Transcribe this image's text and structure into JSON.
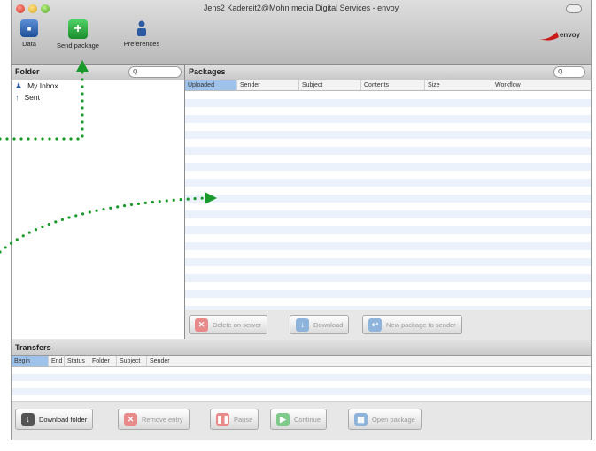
{
  "window": {
    "title": "Jens2 Kadereit2@Mohn media Digital Services - envoy"
  },
  "toolbar": {
    "data_label": "Data",
    "send_label": "Send package",
    "prefs_label": "Preferences"
  },
  "brand": {
    "logo_text": "envoy",
    "accent": "#cc1a1a"
  },
  "folders": {
    "header": "Folder",
    "search_placeholder": "Q",
    "items": [
      {
        "label": "My Inbox"
      },
      {
        "label": "Sent"
      }
    ]
  },
  "packages": {
    "header": "Packages",
    "search_placeholder": "Q",
    "columns": [
      "Uploaded",
      "Sender",
      "Subject",
      "Contents",
      "Size",
      "Workflow"
    ],
    "buttons": {
      "delete": "Delete on server",
      "download": "Download",
      "newpkg": "New package to sender"
    }
  },
  "transfers": {
    "header": "Transfers",
    "columns": [
      "Begin",
      "End",
      "Status",
      "Folder",
      "Subject",
      "Sender"
    ],
    "buttons": {
      "download_folder": "Download folder",
      "remove": "Remove entry",
      "pause": "Pause",
      "continue": "Continue",
      "open": "Open package"
    }
  },
  "colors": {
    "annotation": "#1a9a2a",
    "selection": "#9ec2ea"
  }
}
